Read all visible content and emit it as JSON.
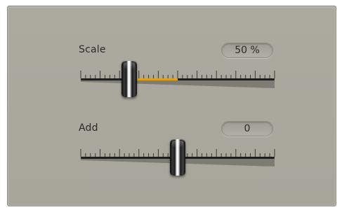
{
  "scale": {
    "label": "Scale",
    "value_text": "50 %",
    "level": 0.25,
    "fill_color": "#e0a21a",
    "fill_start": 0.25,
    "fill_end": 0.5
  },
  "add": {
    "label": "Add",
    "value_text": "0",
    "level": 0.5
  },
  "colors": {
    "panel": "#aaa89d",
    "ink": "#2a2a28",
    "track": "#1e1e1c"
  },
  "icons": {
    "handle": "slider-handle-icon"
  }
}
